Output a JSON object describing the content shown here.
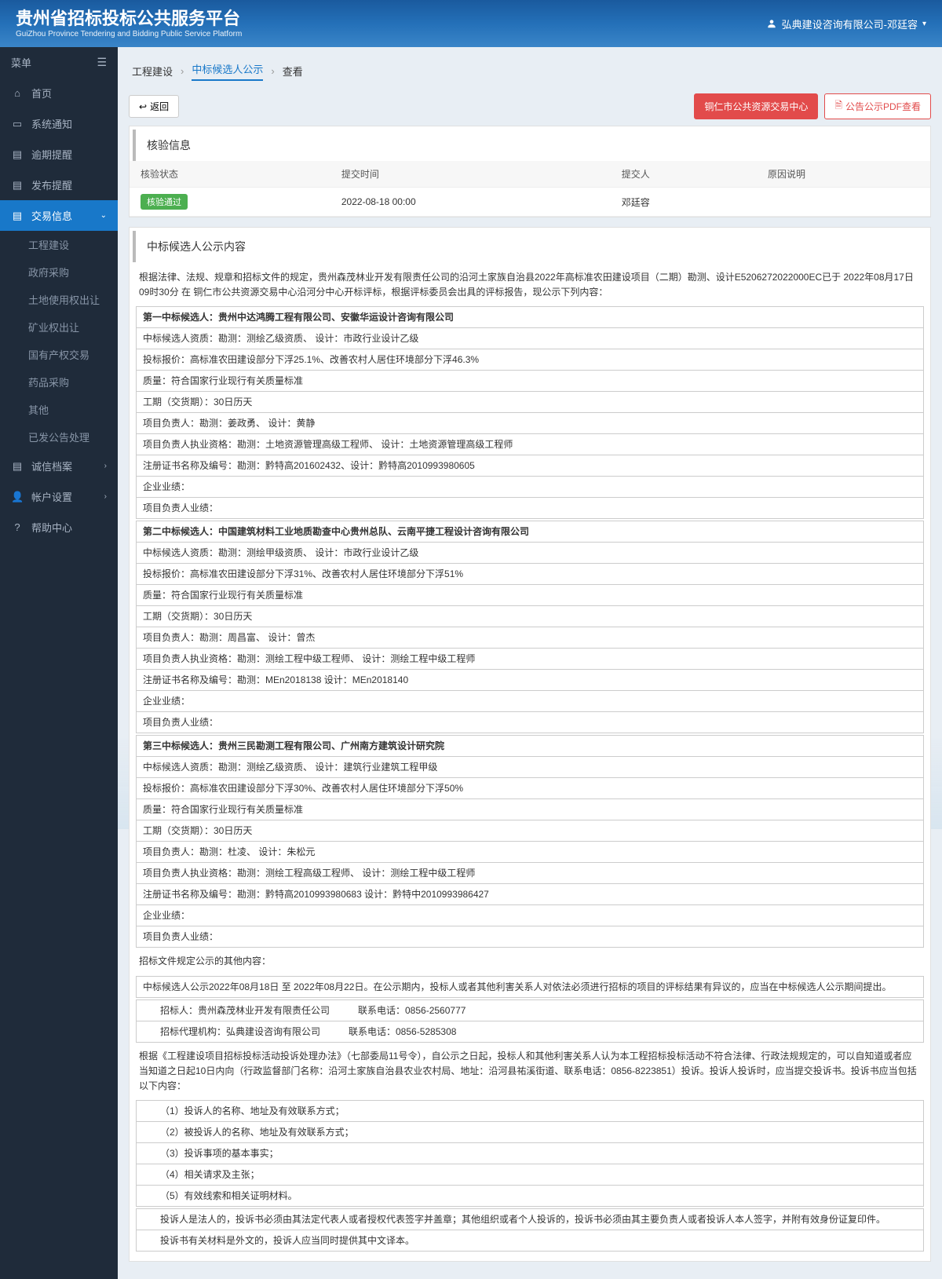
{
  "header": {
    "title": "贵州省招标投标公共服务平台",
    "subtitle": "GuiZhou Province Tendering and Bidding Public Service Platform",
    "user": "弘典建设咨询有限公司-邓廷容"
  },
  "sidebar": {
    "menu_label": "菜单",
    "items": [
      {
        "icon": "⌂",
        "label": "首页"
      },
      {
        "icon": "▭",
        "label": "系统通知"
      },
      {
        "icon": "▤",
        "label": "逾期提醒"
      },
      {
        "icon": "▤",
        "label": "发布提醒"
      },
      {
        "icon": "▤",
        "label": "交易信息",
        "active": true,
        "expanded": true
      },
      {
        "icon": "▤",
        "label": "诚信档案",
        "arrow": true
      },
      {
        "icon": "👤",
        "label": "帐户设置",
        "arrow": true
      },
      {
        "icon": "?",
        "label": "帮助中心"
      }
    ],
    "subs": [
      "工程建设",
      "政府采购",
      "土地使用权出让",
      "矿业权出让",
      "国有产权交易",
      "药品采购",
      "其他",
      "已发公告处理"
    ]
  },
  "breadcrumb": {
    "items": [
      "工程建设",
      "中标候选人公示",
      "查看"
    ]
  },
  "actions": {
    "back": "返回",
    "center": "铜仁市公共资源交易中心",
    "pdf": "公告公示PDF查看"
  },
  "verify": {
    "title": "核验信息",
    "headers": {
      "status": "核验状态",
      "time": "提交时间",
      "submitter": "提交人",
      "reason": "原因说明"
    },
    "row": {
      "status": "核验通过",
      "time": "2022-08-18 00:00",
      "submitter": "邓廷容",
      "reason": ""
    }
  },
  "announce": {
    "title": "中标候选人公示内容",
    "intro": "根据法律、法规、规章和招标文件的规定，贵州森茂林业开发有限责任公司的沿河土家族自治县2022年高标准农田建设项目（二期）勘测、设计E5206272022000EC已于 2022年08月17日 09时30分 在 铜仁市公共资源交易中心沿河分中心开标评标，根据评标委员会出具的评标报告，现公示下列内容：",
    "candidates": [
      {
        "rank": "第一中标候选人：贵州中达鸿腾工程有限公司、安徽华运设计咨询有限公司",
        "rows": [
          "中标候选人资质：勘测：测绘乙级资质、 设计：市政行业设计乙级",
          "投标报价：高标准农田建设部分下浮25.1%、改善农村人居住环境部分下浮46.3%",
          "质量：符合国家行业现行有关质量标准",
          "工期（交货期）：30日历天",
          "项目负责人：勘测：姜政勇、 设计：黄静",
          "项目负责人执业资格：勘测：土地资源管理高级工程师、 设计：土地资源管理高级工程师",
          "注册证书名称及编号：勘测：黔特高201602432、设计：黔特高2010993980605",
          "企业业绩：",
          "项目负责人业绩："
        ]
      },
      {
        "rank": "第二中标候选人：中国建筑材料工业地质勘查中心贵州总队、云南平捷工程设计咨询有限公司",
        "rows": [
          "中标候选人资质：勘测：测绘甲级资质、 设计：市政行业设计乙级",
          "投标报价：高标准农田建设部分下浮31%、改善农村人居住环境部分下浮51%",
          "质量：符合国家行业现行有关质量标准",
          "工期（交货期）：30日历天",
          "项目负责人：勘测：周昌富、 设计：曾杰",
          "项目负责人执业资格：勘测：测绘工程中级工程师、 设计：测绘工程中级工程师",
          "注册证书名称及编号：勘测：MEn2018138 设计：MEn2018140",
          "企业业绩：",
          "项目负责人业绩："
        ]
      },
      {
        "rank": "第三中标候选人：贵州三民勘测工程有限公司、广州南方建筑设计研究院",
        "rows": [
          "中标候选人资质：勘测：测绘乙级资质、 设计：建筑行业建筑工程甲级",
          "投标报价：高标准农田建设部分下浮30%、改善农村人居住环境部分下浮50%",
          "质量：符合国家行业现行有关质量标准",
          "工期（交货期）：30日历天",
          "项目负责人：勘测：杜凌、 设计：朱松元",
          "项目负责人执业资格：勘测：测绘工程高级工程师、 设计：测绘工程中级工程师",
          "注册证书名称及编号：勘测：黔特高2010993980683 设计：黔特中2010993986427",
          "企业业绩：",
          "项目负责人业绩："
        ]
      }
    ],
    "other_title": "招标文件规定公示的其他内容：",
    "publicity": "中标候选人公示2022年08月18日 至 2022年08月22日。在公示期内，投标人或者其他利害关系人对依法必须进行招标的项目的评标结果有异议的，应当在中标候选人公示期间提出。",
    "contacts": [
      "招标人：贵州森茂林业开发有限责任公司　　　联系电话：0856-2560777",
      "招标代理机构：弘典建设咨询有限公司　　　联系电话：0856-5285308"
    ],
    "complaint_intro": "根据《工程建设项目招标投标活动投诉处理办法》（七部委局11号令），自公示之日起，投标人和其他利害关系人认为本工程招标投标活动不符合法律、行政法规规定的，可以自知道或者应当知道之日起10日内向（行政监督部门名称：沿河土家族自治县农业农村局、地址：沿河县祐溪街道、联系电话：0856-8223851）投诉。投诉人投诉时，应当提交投诉书。投诉书应当包括以下内容：",
    "complaint_items": [
      "（1）投诉人的名称、地址及有效联系方式；",
      "（2）被投诉人的名称、地址及有效联系方式；",
      "（3）投诉事项的基本事实；",
      "（4）相关请求及主张；",
      "（5）有效线索和相关证明材料。"
    ],
    "complaint_notes": [
      "投诉人是法人的，投诉书必须由其法定代表人或者授权代表签字并盖章；其他组织或者个人投诉的，投诉书必须由其主要负责人或者投诉人本人签字，并附有效身份证复印件。",
      "投诉书有关材料是外文的，投诉人应当同时提供其中文译本。"
    ]
  }
}
